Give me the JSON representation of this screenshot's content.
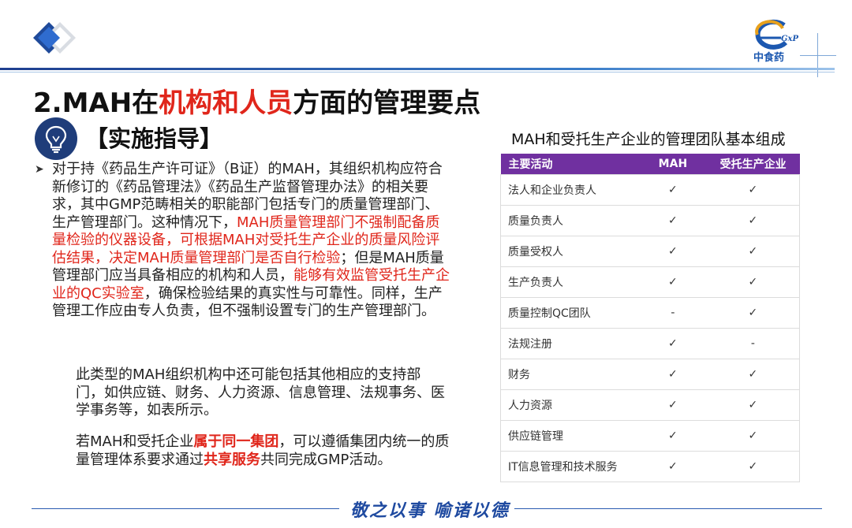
{
  "header": {
    "brand_text": "中食药",
    "brand_sub": "GxP"
  },
  "title": {
    "prefix": "2.MAH在",
    "highlight": "机构和人员",
    "suffix": "方面的管理要点"
  },
  "guide_heading": "【实施指导】",
  "paragraph1": {
    "t1": "对于持《药品生产许可证》（B证）的MAH，其组织机构应符合新修订的《药品管理法》《药品生产监督管理办法》的相关要求，其中GMP范畴相关的职能部门包括专门的质量管理部门、生产管理部门。这种情况下，",
    "r1": "MAH质量管理部门不强制配备质量检验的仪器设备，可根据MAH对受托生产企业的质量风险评估结果，决定MAH质量管理部门是否自行检验",
    "t2": "；但是MAH质量管理部门应当具备相应的机构和人员，",
    "r2": "能够有效监管受托生产企业的QC实验室",
    "t3": "，确保检验结果的真实性与可靠性。同样，生产管理工作应由专人负责，但不强制设置专门的生产管理部门。"
  },
  "paragraph2": "此类型的MAH组织机构中还可能包括其他相应的支持部门，如供应链、财务、人力资源、信息管理、法规事务、医学事务等，如表所示。",
  "paragraph3": {
    "t1": "若MAH和受托企业",
    "r1": "属于同一集团",
    "t2": "，可以遵循集团内统一的质量管理体系要求通过",
    "r2": "共享服务",
    "t3": "共同完成GMP活动。"
  },
  "table": {
    "caption": "MAH和受托生产企业的管理团队基本组成",
    "headers": [
      "主要活动",
      "MAH",
      "受托生产企业"
    ],
    "rows": [
      [
        "法人和企业负责人",
        "✓",
        "✓"
      ],
      [
        "质量负责人",
        "✓",
        "✓"
      ],
      [
        "质量受权人",
        "✓",
        "✓"
      ],
      [
        "生产负责人",
        "✓",
        "✓"
      ],
      [
        "质量控制QC团队",
        "-",
        "✓"
      ],
      [
        "法规注册",
        "✓",
        "-"
      ],
      [
        "财务",
        "✓",
        "✓"
      ],
      [
        "人力资源",
        "✓",
        "✓"
      ],
      [
        "供应链管理",
        "✓",
        "✓"
      ],
      [
        "IT信息管理和技术服务",
        "✓",
        "✓"
      ]
    ]
  },
  "footer_motto": "敬之以事  喻诸以德",
  "colors": {
    "accent_red": "#e0261b",
    "table_header": "#7030a0",
    "navy": "#1f3d7a"
  }
}
